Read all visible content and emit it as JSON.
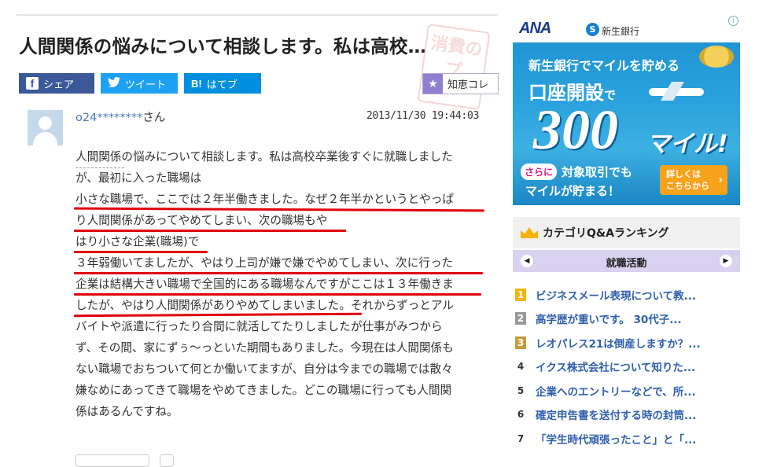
{
  "question": {
    "title": "人間関係の悩みについて相談します。私は高校…",
    "stamp_text": "消費のプ"
  },
  "share": {
    "facebook_icon": "f",
    "facebook_label": "シェア",
    "twitter_icon": "twitter-bird-icon",
    "twitter_label": "ツイート",
    "hatena_icon": "B!",
    "hatena_label": "はてブ",
    "chiekore_label": "知恵コレ"
  },
  "answer": {
    "user_id": "o24********",
    "user_suffix": "さん",
    "date": "2013/11/30 19:44:03",
    "lines": [
      "人間関係の悩みについて相談します。私は高校卒業後すぐに就職しました",
      "が、最初に入った職場は",
      "小さな職場で、ここでは２年半働きました。なぜ２年半かというとやっぱ",
      "り人間関係があってやめてしまい、次の職場もや",
      "はり小さな企業(職場)で",
      "３年弱働いてましたが、やはり上司が嫌で嫌でやめてしまい、次に行った",
      "企業は結構大きい職場で全国的にある職場なんですがここは１３年働きま",
      "したが、やはり人間関係がありやめてしまいました。それからずっとアル",
      "バイトや派遣に行ったり合間に就活してたりしましたが仕事がみつから",
      "ず、その間、家にずぅ～っといた期間もありました。今現在は人間関係も",
      "ない職場でおちついて何とか働いてますが、自分は今までの職場では散々",
      "嫌なめにあってきて職場をやめてきました。どこの職場に行っても人間関",
      "係はあるんですね。"
    ]
  },
  "ad": {
    "brand": "ANA",
    "bank": "新生銀行",
    "bank_logo": "S",
    "line1": "新生銀行でマイルを貯める",
    "line2": "口座開設",
    "line2_suffix": "で",
    "amount": "300",
    "unit": "マイル!",
    "sarani": "さらに",
    "line3": "対象取引でも",
    "line4": "マイルが貯まる！",
    "cta_line1": "詳しくは",
    "cta_line2": "こちらから",
    "info_icon": "i"
  },
  "ranking": {
    "header": "カテゴリQ&Aランキング",
    "category": "就職活動",
    "items": [
      {
        "rank": "1",
        "text": "ビジネスメール表現について教..."
      },
      {
        "rank": "2",
        "text": "高学歴が重いです。 30代子..."
      },
      {
        "rank": "3",
        "text": "レオパレス21は倒産しますか？..."
      },
      {
        "rank": "4",
        "text": "イクス株式会社について知りた..."
      },
      {
        "rank": "5",
        "text": "企業へのエントリーなどで、所..."
      },
      {
        "rank": "6",
        "text": "確定申告書を送付する時の封筒..."
      },
      {
        "rank": "7",
        "text": "「学生時代頑張ったこと」と「..."
      }
    ]
  },
  "colors": {
    "facebook": "#3b5998",
    "twitter": "#1da1f2",
    "hatena": "#008fde",
    "chiekore": "#8f7fd0",
    "underline": "#e0000d",
    "link": "#3060b0",
    "category_bg": "#d9d1f0"
  }
}
